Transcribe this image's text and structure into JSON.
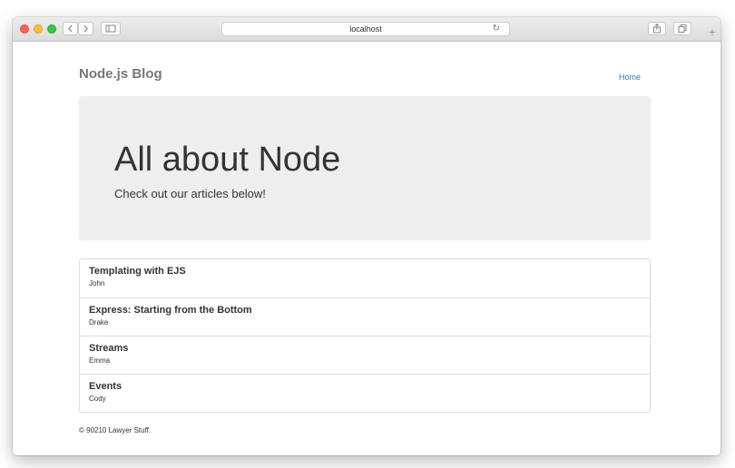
{
  "browser": {
    "url": "localhost",
    "icons": {
      "back": "chevron-left-icon",
      "forward": "chevron-right-icon",
      "sidebar": "sidebar-icon",
      "reload": "reload-icon",
      "share": "share-icon",
      "tabs": "tabs-icon",
      "new_tab": "plus-icon"
    }
  },
  "navbar": {
    "brand": "Node.js Blog",
    "links": [
      {
        "label": "Home"
      }
    ]
  },
  "jumbotron": {
    "title": "All about Node",
    "subtitle": "Check out our articles below!"
  },
  "articles": [
    {
      "title": "Templating with EJS",
      "author": "John"
    },
    {
      "title": "Express: Starting from the Bottom",
      "author": "Drake"
    },
    {
      "title": "Streams",
      "author": "Emma"
    },
    {
      "title": "Events",
      "author": "Cody"
    }
  ],
  "footer": {
    "text": "© 90210 Lawyer Stuff."
  },
  "colors": {
    "link": "#337ab7",
    "jumbotron_bg": "#eeeeee",
    "brand_text": "#777777",
    "close": "#fc605b",
    "minimize": "#fdbc40",
    "maximize": "#34c84a"
  }
}
